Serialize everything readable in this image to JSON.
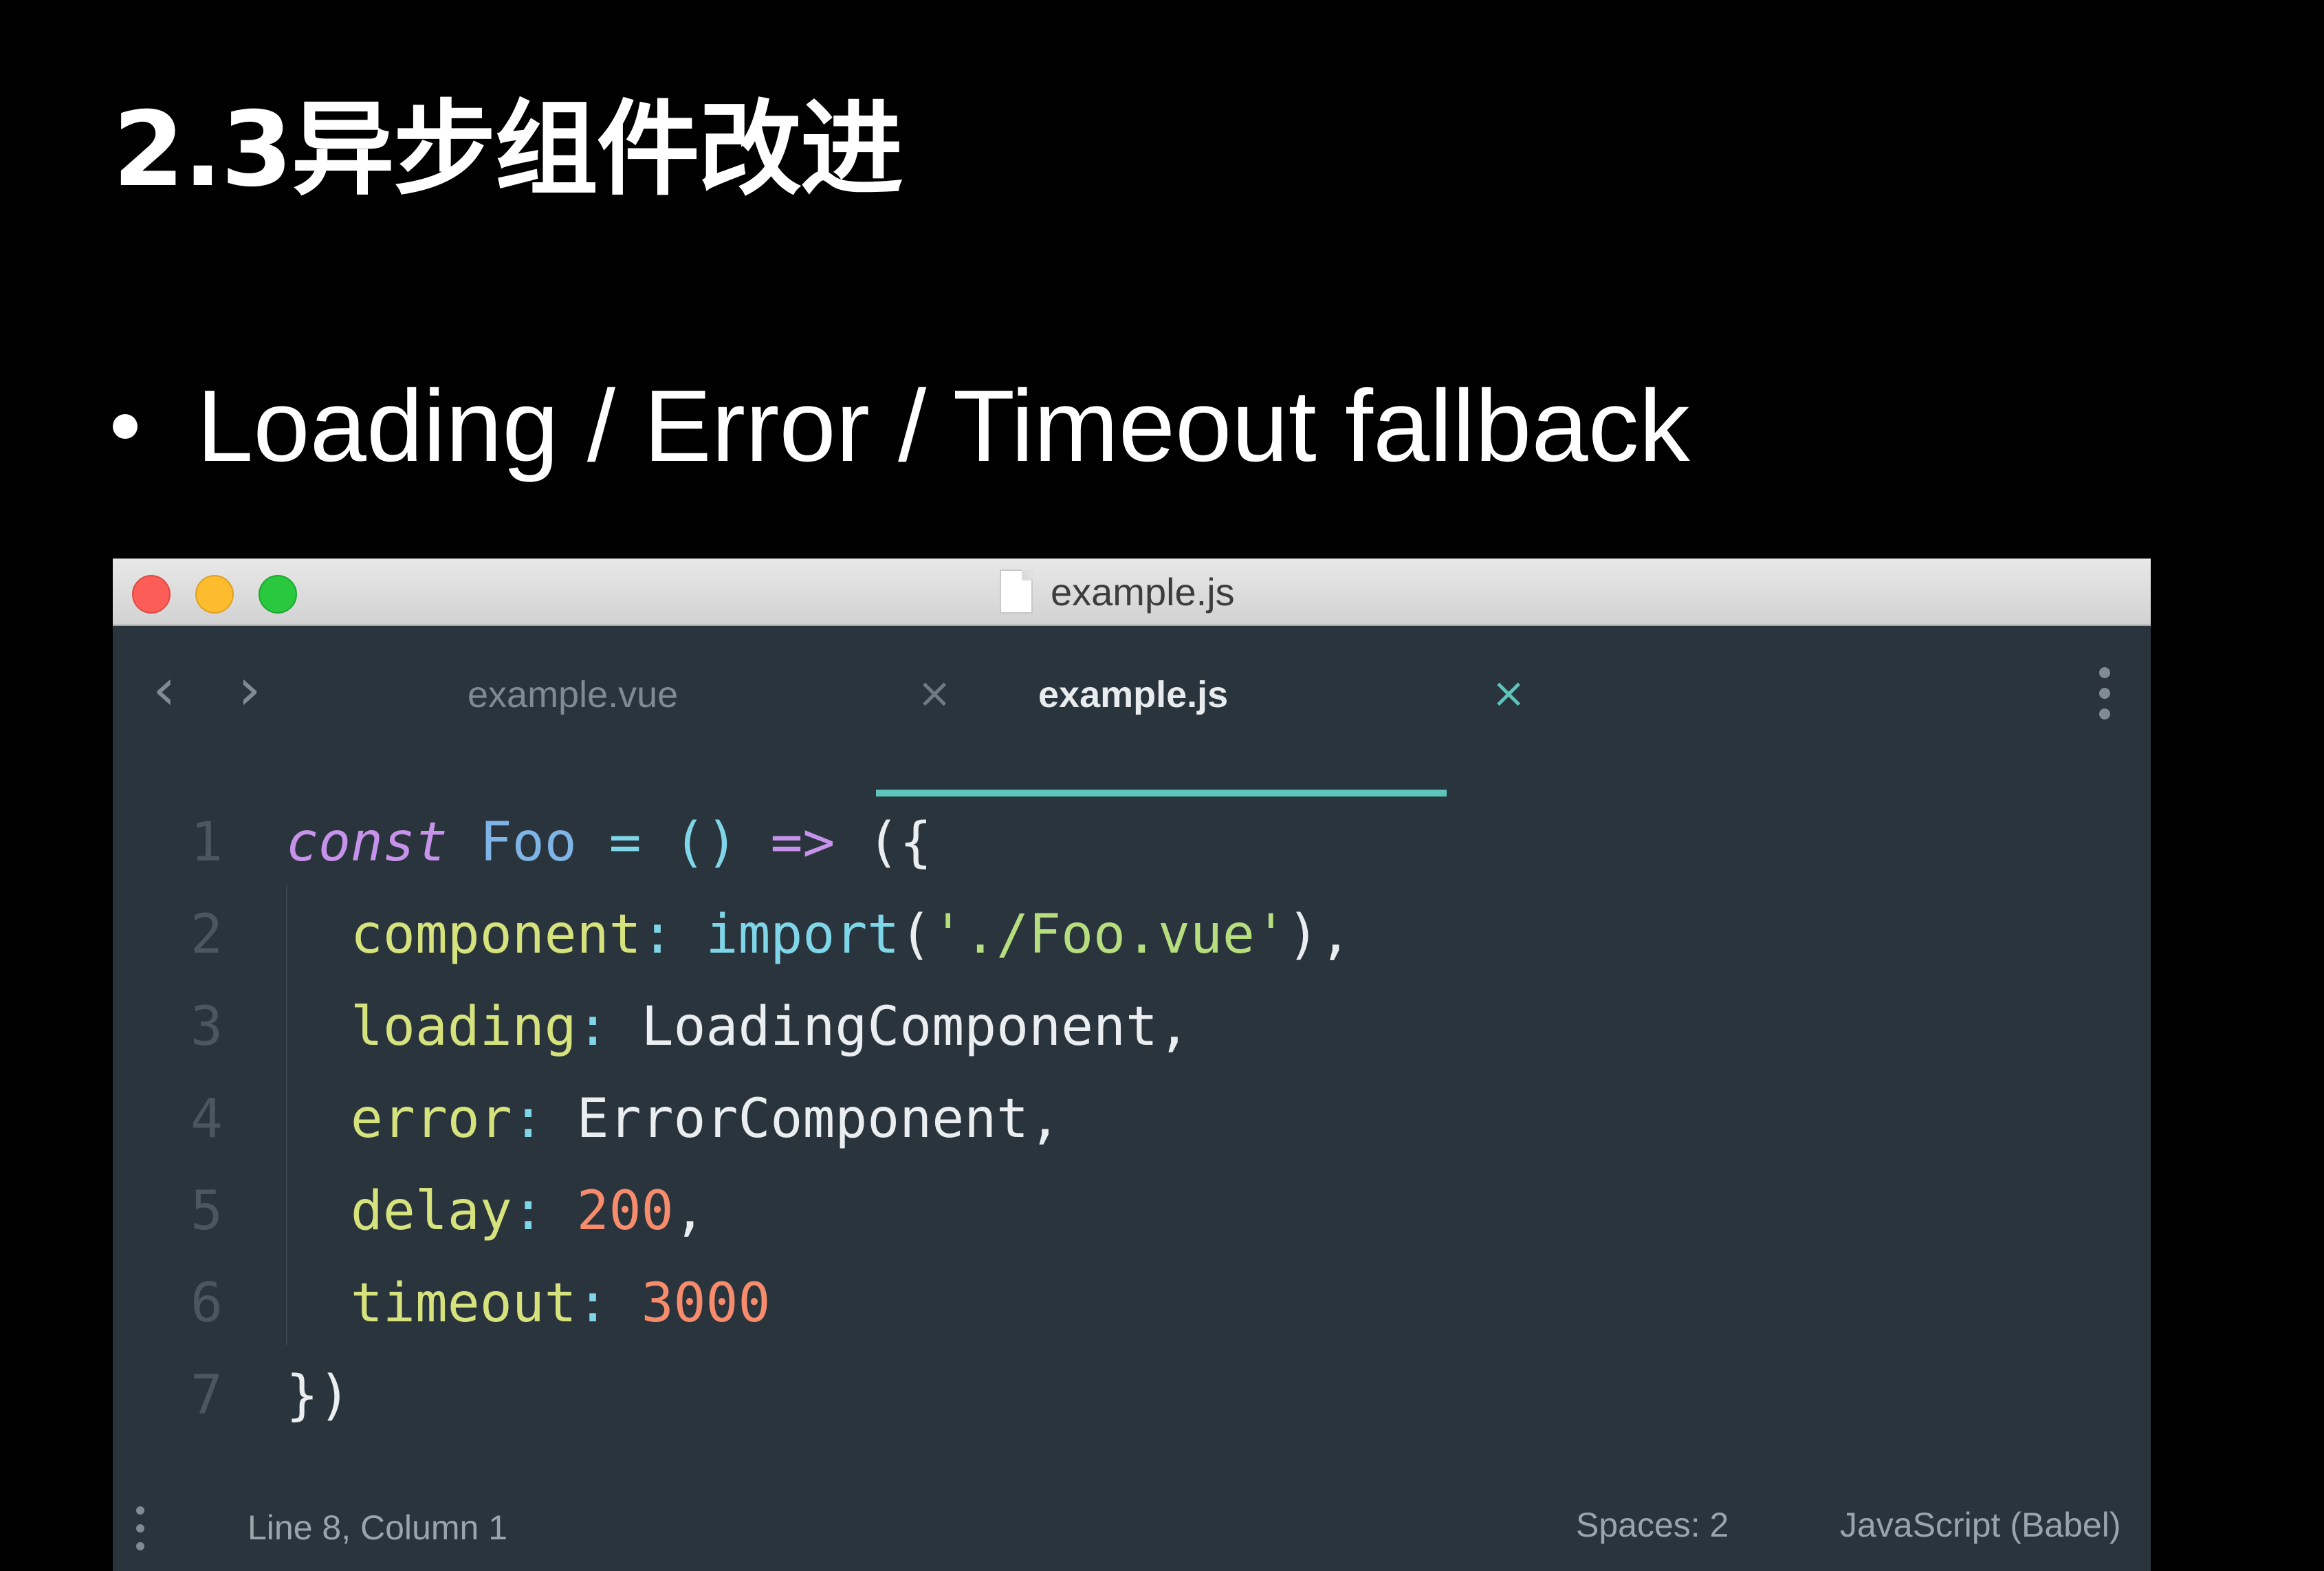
{
  "slide": {
    "title": "2.3异步组件改进",
    "bullet": "Loading / Error / Timeout fallback"
  },
  "window": {
    "title": "example.js",
    "traffic_colors": {
      "close": "#fc5e57",
      "minimize": "#fdbb2e",
      "zoom": "#29c83f"
    }
  },
  "tabs": [
    {
      "label": "example.vue",
      "active": false
    },
    {
      "label": "example.js",
      "active": true
    }
  ],
  "nav": {
    "back_icon": "chevron-left-icon",
    "forward_icon": "chevron-right-icon"
  },
  "editor": {
    "lines": [
      {
        "num": "1",
        "tokens": [
          {
            "t": "const",
            "c": "kw"
          },
          {
            "t": " ",
            "c": "punc"
          },
          {
            "t": "Foo",
            "c": "name"
          },
          {
            "t": " ",
            "c": "punc"
          },
          {
            "t": "=",
            "c": "op"
          },
          {
            "t": " ",
            "c": "punc"
          },
          {
            "t": "()",
            "c": "op"
          },
          {
            "t": " ",
            "c": "punc"
          },
          {
            "t": "=>",
            "c": "kw-plain"
          },
          {
            "t": " ",
            "c": "punc"
          },
          {
            "t": "({",
            "c": "punc"
          }
        ]
      },
      {
        "num": "2",
        "tokens": [
          {
            "t": "  ",
            "c": "punc"
          },
          {
            "t": "component",
            "c": "prop"
          },
          {
            "t": ":",
            "c": "op"
          },
          {
            "t": " ",
            "c": "punc"
          },
          {
            "t": "import",
            "c": "fn"
          },
          {
            "t": "(",
            "c": "punc"
          },
          {
            "t": "'./Foo.vue'",
            "c": "str"
          },
          {
            "t": "),",
            "c": "punc"
          }
        ]
      },
      {
        "num": "3",
        "tokens": [
          {
            "t": "  ",
            "c": "punc"
          },
          {
            "t": "loading",
            "c": "prop"
          },
          {
            "t": ":",
            "c": "op"
          },
          {
            "t": " ",
            "c": "punc"
          },
          {
            "t": "LoadingComponent",
            "c": "ident"
          },
          {
            "t": ",",
            "c": "punc"
          }
        ]
      },
      {
        "num": "4",
        "tokens": [
          {
            "t": "  ",
            "c": "punc"
          },
          {
            "t": "error",
            "c": "prop"
          },
          {
            "t": ":",
            "c": "op"
          },
          {
            "t": " ",
            "c": "punc"
          },
          {
            "t": "ErrorComponent",
            "c": "ident"
          },
          {
            "t": ",",
            "c": "punc"
          }
        ]
      },
      {
        "num": "5",
        "tokens": [
          {
            "t": "  ",
            "c": "punc"
          },
          {
            "t": "delay",
            "c": "prop"
          },
          {
            "t": ":",
            "c": "op"
          },
          {
            "t": " ",
            "c": "punc"
          },
          {
            "t": "200",
            "c": "num"
          },
          {
            "t": ",",
            "c": "punc"
          }
        ]
      },
      {
        "num": "6",
        "tokens": [
          {
            "t": "  ",
            "c": "punc"
          },
          {
            "t": "timeout",
            "c": "prop"
          },
          {
            "t": ":",
            "c": "op"
          },
          {
            "t": " ",
            "c": "punc"
          },
          {
            "t": "3000",
            "c": "num"
          }
        ]
      },
      {
        "num": "7",
        "tokens": [
          {
            "t": "})",
            "c": "punc"
          }
        ]
      }
    ]
  },
  "statusbar": {
    "position": "Line 8, Column 1",
    "spaces": "Spaces: 2",
    "syntax": "JavaScript (Babel)"
  },
  "colors": {
    "background": "#000000",
    "editor_bg": "#2a343d",
    "accent": "#5fc4bb",
    "keyword": "#c792ea",
    "property": "#d6e27c",
    "string": "#b6dd7e",
    "number": "#f78c6c"
  }
}
